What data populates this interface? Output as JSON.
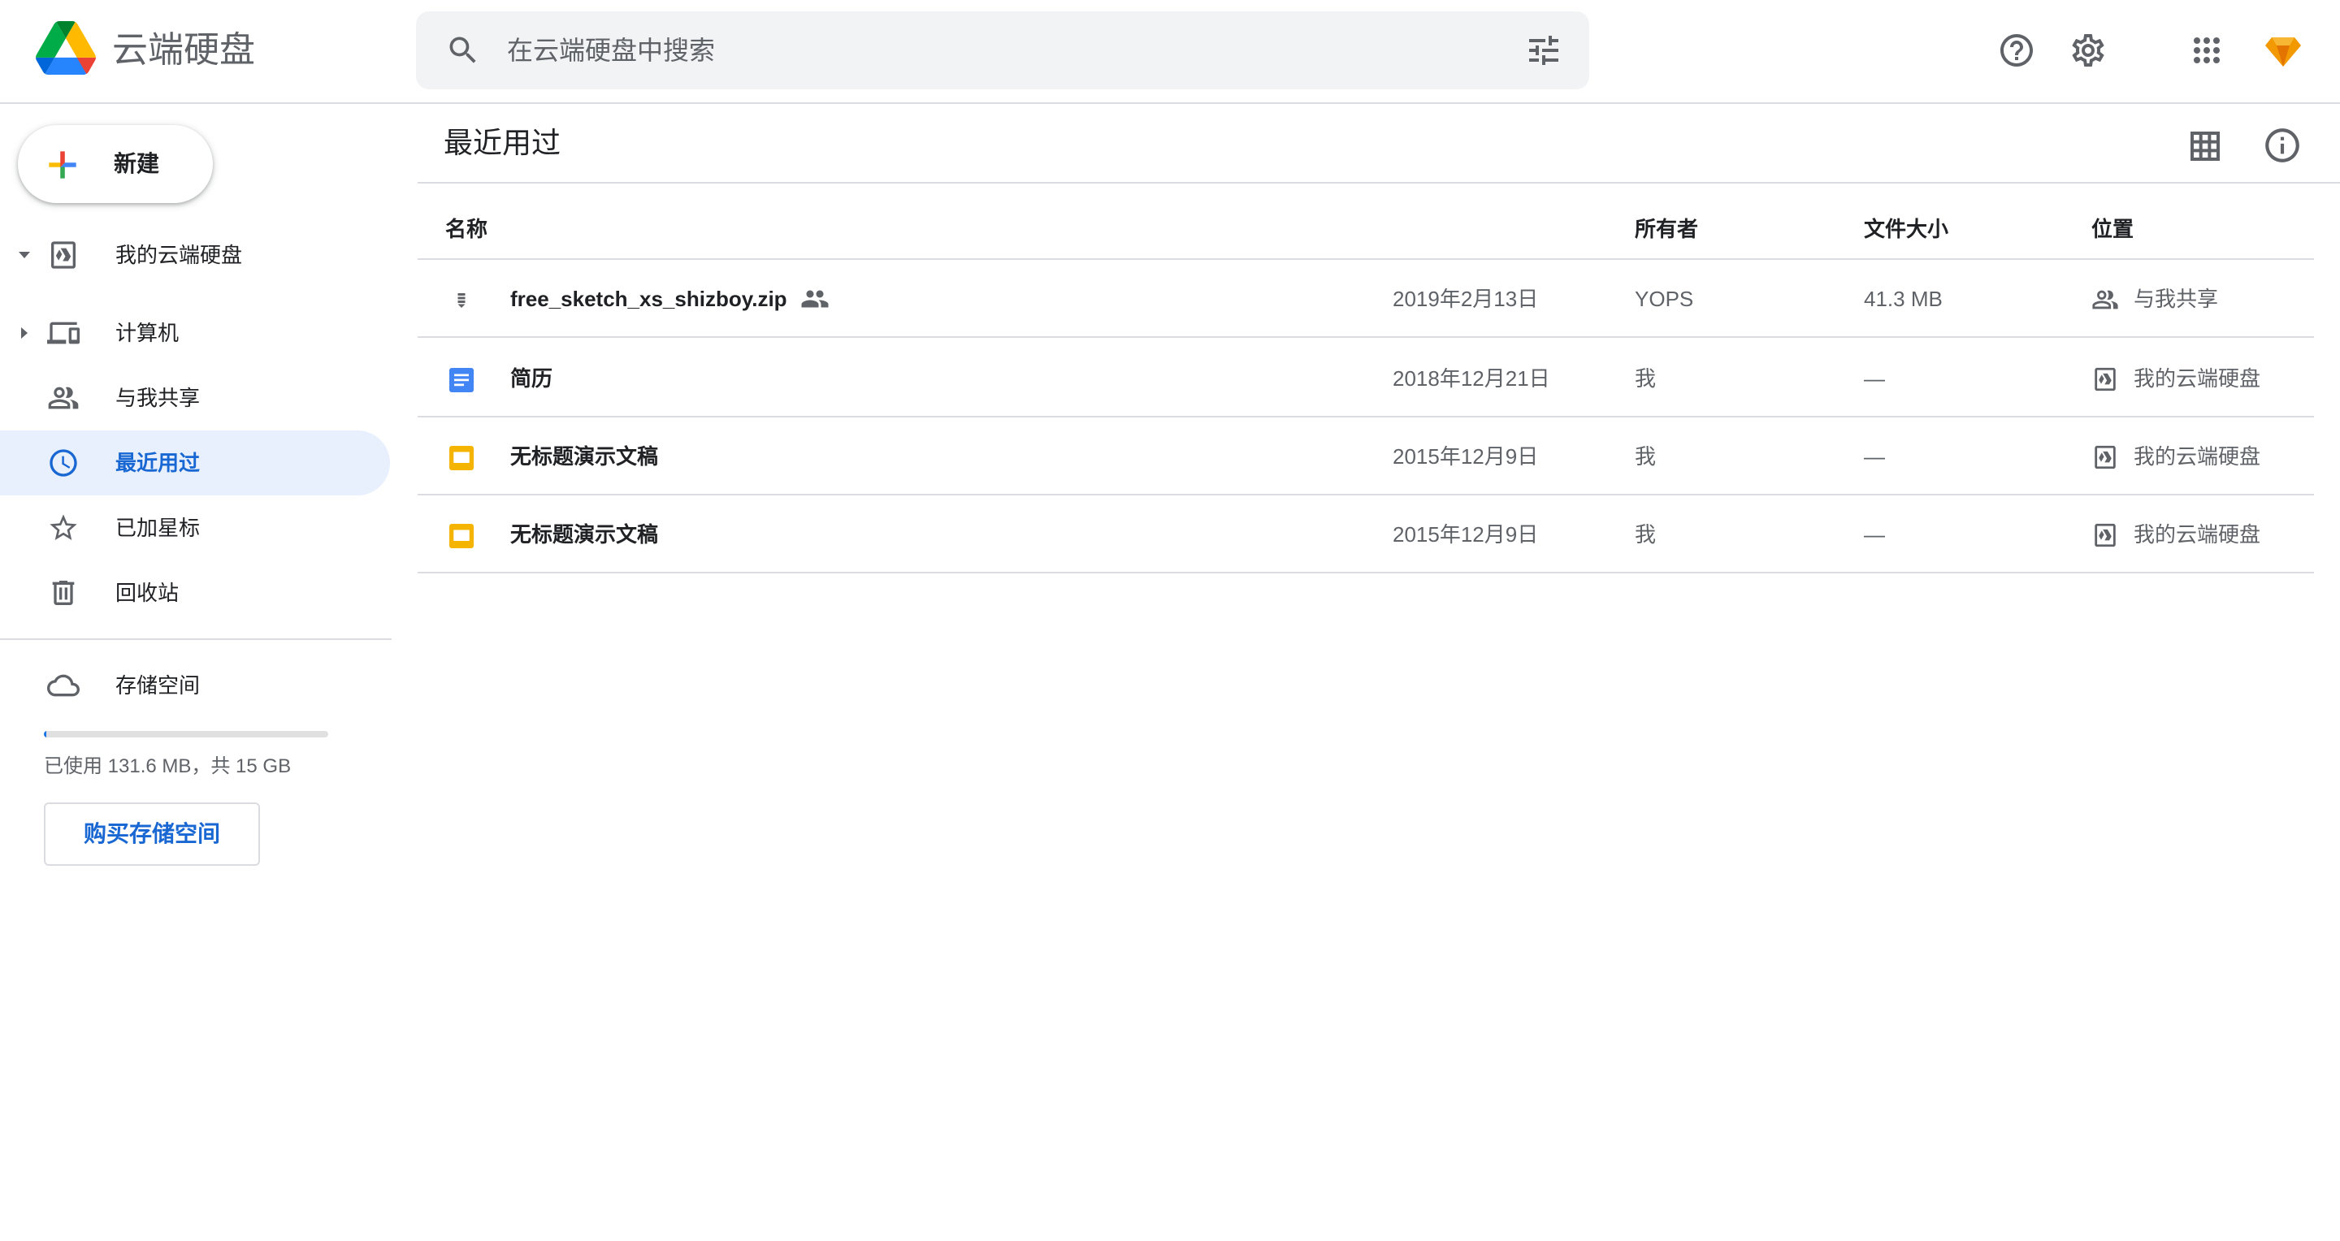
{
  "app": {
    "title": "云端硬盘"
  },
  "search": {
    "placeholder": "在云端硬盘中搜索",
    "value": ""
  },
  "header_icons": [
    "help-icon",
    "settings-icon",
    "apps-grid-icon",
    "account-avatar"
  ],
  "sidebar": {
    "new_label": "新建",
    "items": [
      {
        "label": "我的云端硬盘",
        "icon": "my-drive-icon",
        "expander": "expanded"
      },
      {
        "label": "计算机",
        "icon": "computers-icon",
        "expander": "collapsed"
      },
      {
        "label": "与我共享",
        "icon": "shared-with-me-icon"
      },
      {
        "label": "最近用过",
        "icon": "recent-clock-icon",
        "active": true
      },
      {
        "label": "已加星标",
        "icon": "star-icon"
      },
      {
        "label": "回收站",
        "icon": "trash-icon"
      }
    ],
    "storage": {
      "label": "存储空间",
      "usage_text": "已使用 131.6 MB，共 15 GB",
      "used_fraction": 0.0088,
      "buy_label": "购买存储空间"
    }
  },
  "main": {
    "title": "最近用过",
    "columns": {
      "name": "名称",
      "owner": "所有者",
      "size": "文件大小",
      "location": "位置"
    },
    "rows": [
      {
        "name": "free_sketch_xs_shizboy.zip",
        "type": "zip",
        "shared": true,
        "date": "2019年2月13日",
        "owner": "YOPS",
        "size": "41.3 MB",
        "location": "与我共享",
        "location_icon": "shared-with-me-icon"
      },
      {
        "name": "简历",
        "type": "docs",
        "shared": false,
        "date": "2018年12月21日",
        "owner": "我",
        "size": "—",
        "location": "我的云端硬盘",
        "location_icon": "my-drive-icon"
      },
      {
        "name": "无标题演示文稿",
        "type": "slides",
        "shared": false,
        "date": "2015年12月9日",
        "owner": "我",
        "size": "—",
        "location": "我的云端硬盘",
        "location_icon": "my-drive-icon"
      },
      {
        "name": "无标题演示文稿",
        "type": "slides",
        "shared": false,
        "date": "2015年12月9日",
        "owner": "我",
        "size": "—",
        "location": "我的云端硬盘",
        "location_icon": "my-drive-icon"
      }
    ]
  },
  "colors": {
    "accent_blue": "#1a73e8",
    "active_bg": "#e8f0fe",
    "active_text": "#1967d2",
    "docs_blue": "#4285f4",
    "slides_yellow": "#f4b400",
    "avatar_orange": "#f29900"
  }
}
